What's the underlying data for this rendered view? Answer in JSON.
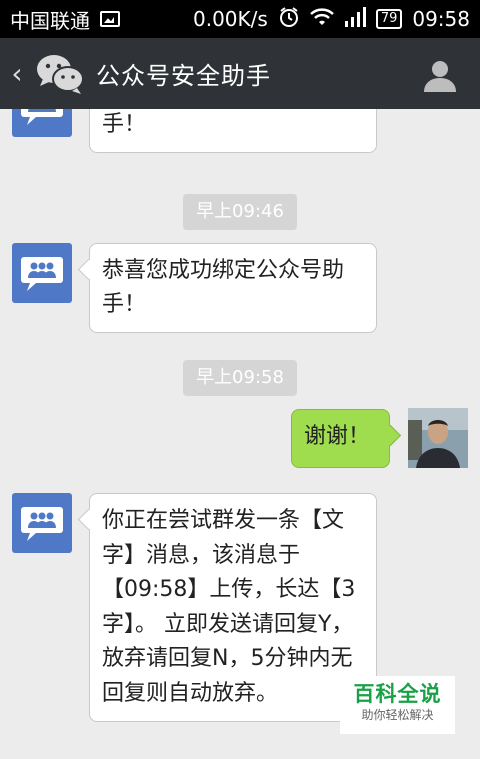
{
  "status": {
    "carrier": "中国联通",
    "speed": "0.00K/s",
    "battery": "79",
    "time": "09:58"
  },
  "titlebar": {
    "back_icon": "chevron-left-icon",
    "app_icon": "wechat-icon",
    "title": "公众号安全助手",
    "profile_icon": "person-icon"
  },
  "messages": {
    "partial_text": "恭喜您成功绑定公众号助手！",
    "time1": "早上09:46",
    "msg1": "恭喜您成功绑定公众号助手！",
    "time2": "早上09:58",
    "msg_me": "谢谢！",
    "msg2": "你正在尝试群发一条【文字】消息，该消息于【09:58】上传，长达【3字】。 立即发送请回复Y，放弃请回复N，5分钟内无回复则自动放弃。"
  },
  "watermark": {
    "title": "百科全说",
    "subtitle": "助你轻松解决"
  },
  "colors": {
    "titlebar": "#2f3236",
    "bubble_me": "#9fdc4e",
    "avatar_group": "#4f79c6"
  }
}
